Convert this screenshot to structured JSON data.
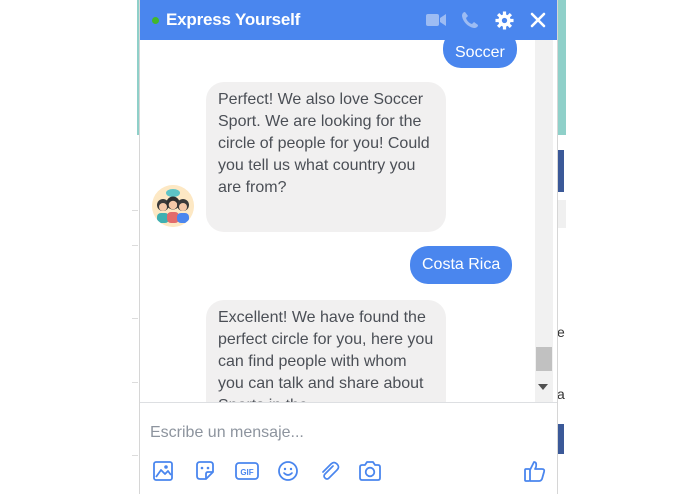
{
  "chat": {
    "title": "Express Yourself",
    "header_icons": [
      "video-icon",
      "phone-icon",
      "gear-icon",
      "close-icon"
    ]
  },
  "messages": [
    {
      "from": "me",
      "text": "Soccer"
    },
    {
      "from": "bot",
      "text": "Perfect! We also love Soccer Sport. We are looking for the circle of people for you! Could you tell us what country you are from?"
    },
    {
      "from": "me",
      "text": "Costa Rica"
    },
    {
      "from": "bot",
      "text": "Excellent! We have found the perfect circle for you, here you can find people with whom you can talk and share about Sports in the"
    }
  ],
  "composer": {
    "placeholder": "Escribe un mensaje...",
    "toolbar_icons": [
      "image-icon",
      "sticker-icon",
      "gif-icon",
      "emoji-icon",
      "attachment-icon",
      "camera-icon",
      "like-icon"
    ]
  },
  "background": {
    "side_letters": [
      "e",
      "a"
    ]
  },
  "colors": {
    "header": "#4a86ee",
    "outgoing_bubble": "#4a86ee",
    "incoming_bubble": "#f1f0f0",
    "online": "#42b72a"
  }
}
